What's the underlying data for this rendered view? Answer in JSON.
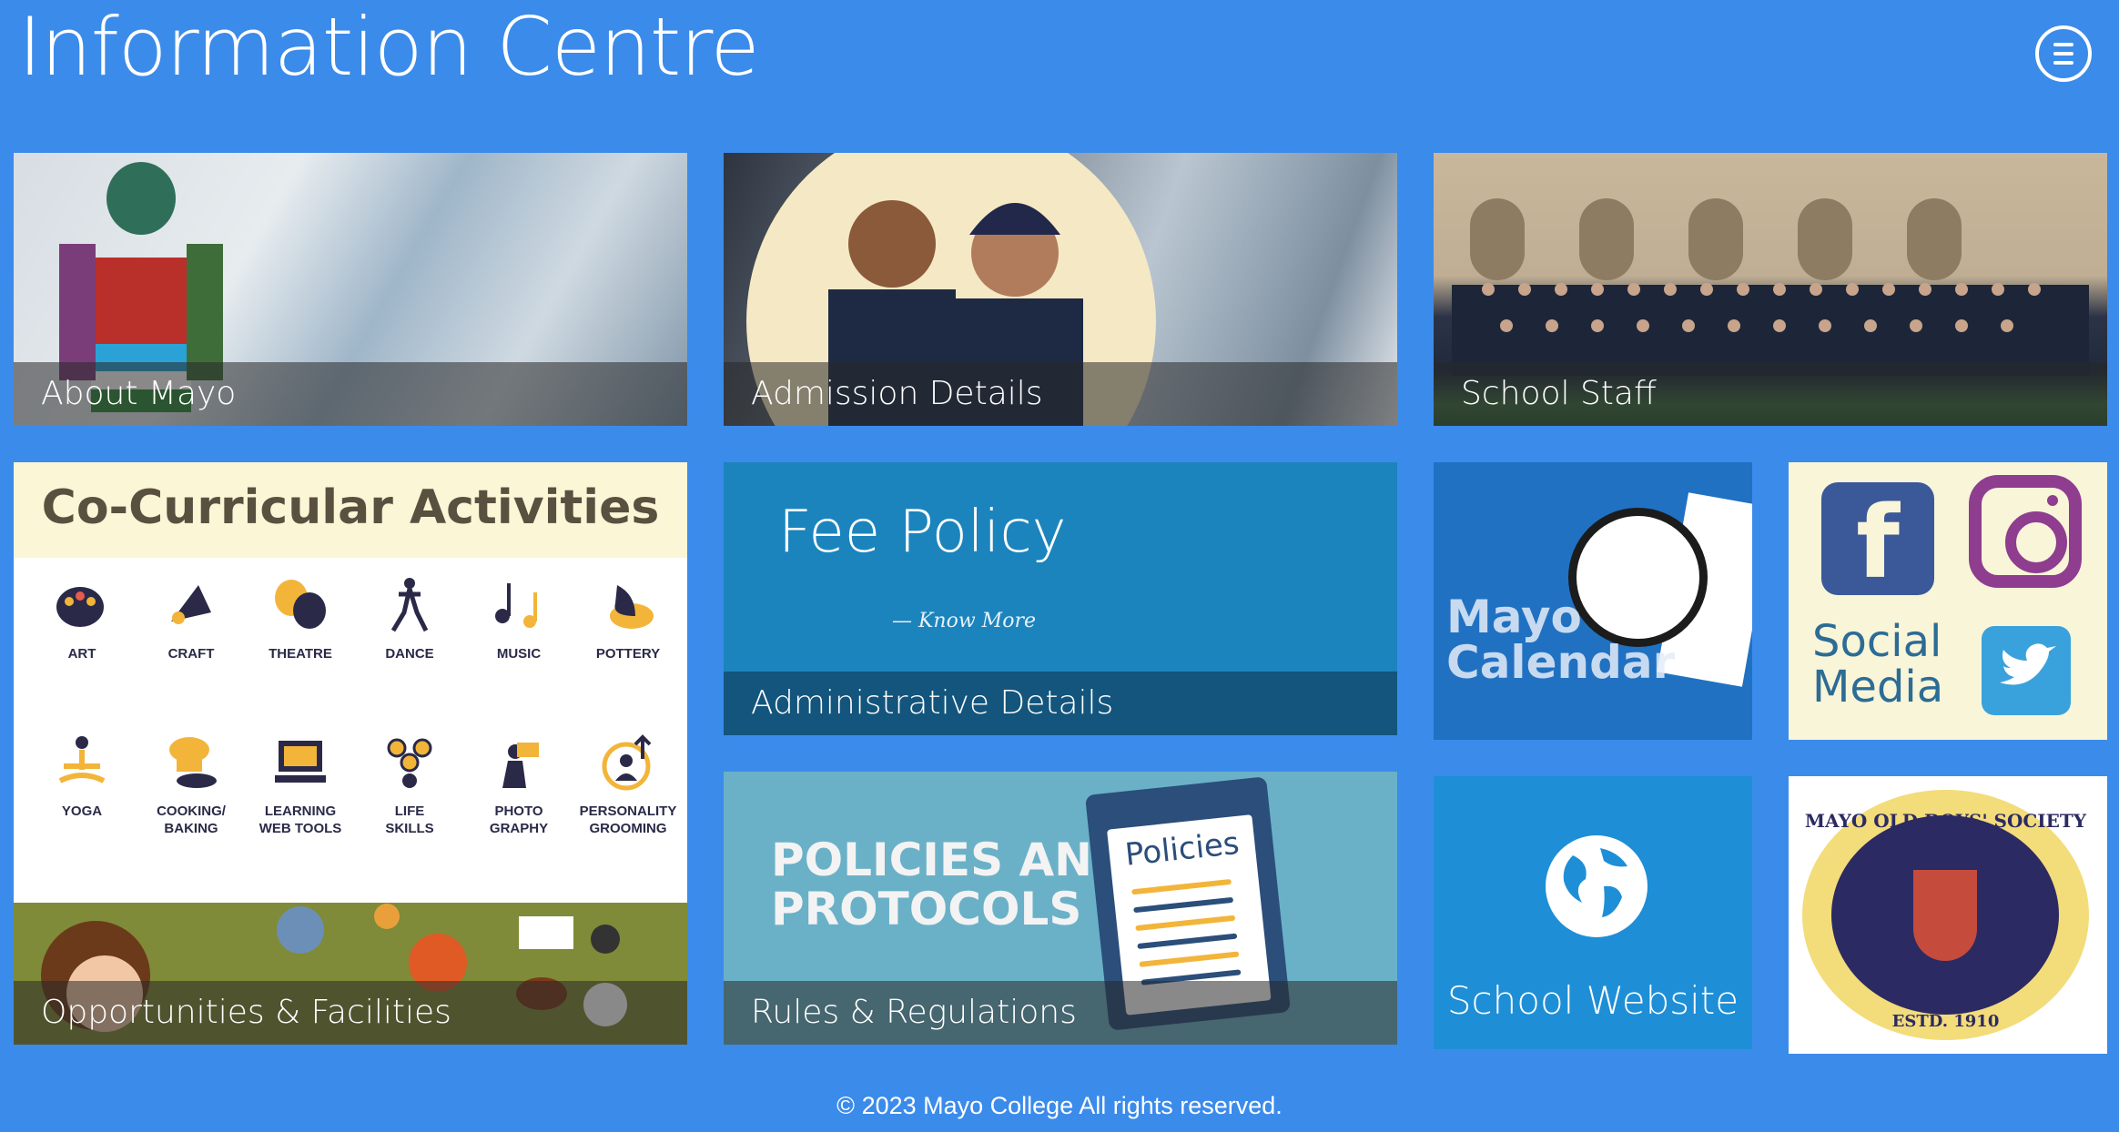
{
  "header": {
    "title": "Information Centre",
    "menu_icon": "hamburger-menu-icon"
  },
  "tiles": {
    "about": {
      "caption": "About Mayo"
    },
    "admission": {
      "caption": "Admission Details"
    },
    "staff": {
      "caption": "School Staff"
    },
    "cocurricular": {
      "heading": "Co-Curricular Activities",
      "caption": "Opportunities & Facilities",
      "items": [
        {
          "label": "ART",
          "icon": "palette-icon"
        },
        {
          "label": "CRAFT",
          "icon": "scissors-icon"
        },
        {
          "label": "THEATRE",
          "icon": "theatre-masks-icon"
        },
        {
          "label": "DANCE",
          "icon": "dancer-icon"
        },
        {
          "label": "MUSIC",
          "icon": "music-notes-icon"
        },
        {
          "label": "POTTERY",
          "icon": "pottery-icon"
        },
        {
          "label": "YOGA",
          "icon": "yoga-icon"
        },
        {
          "label": "COOKING/\nBAKING",
          "icon": "chef-hat-icon"
        },
        {
          "label": "LEARNING\nWEB TOOLS",
          "icon": "computer-icon"
        },
        {
          "label": "LIFE\nSKILLS",
          "icon": "life-skills-icon"
        },
        {
          "label": "PHOTO\nGRAPHY",
          "icon": "camera-icon"
        },
        {
          "label": "PERSONALITY\nGROOMING",
          "icon": "person-growth-icon"
        }
      ]
    },
    "fee": {
      "title": "Fee Policy",
      "know_more": "— Know More",
      "caption": "Administrative Details"
    },
    "policies": {
      "banner_line1": "POLICIES AND",
      "banner_line2": "PROTOCOLS",
      "clipboard_title": "Policies",
      "caption": "Rules & Regulations"
    },
    "calendar": {
      "line1": "Mayo",
      "line2": "Calendar"
    },
    "social": {
      "line1": "Social",
      "line2": "Media"
    },
    "website": {
      "label": "School Website"
    },
    "old_boys": {
      "seal_top": "MAYO OLD BOYS' SOCIETY",
      "seal_bottom": "ESTD. 1910"
    }
  },
  "footer": {
    "text": "© 2023 Mayo College All rights reserved."
  },
  "colors": {
    "background": "#3b8beb",
    "fee_tile": "#1b84bd",
    "website_tile": "#1e8fd6"
  }
}
